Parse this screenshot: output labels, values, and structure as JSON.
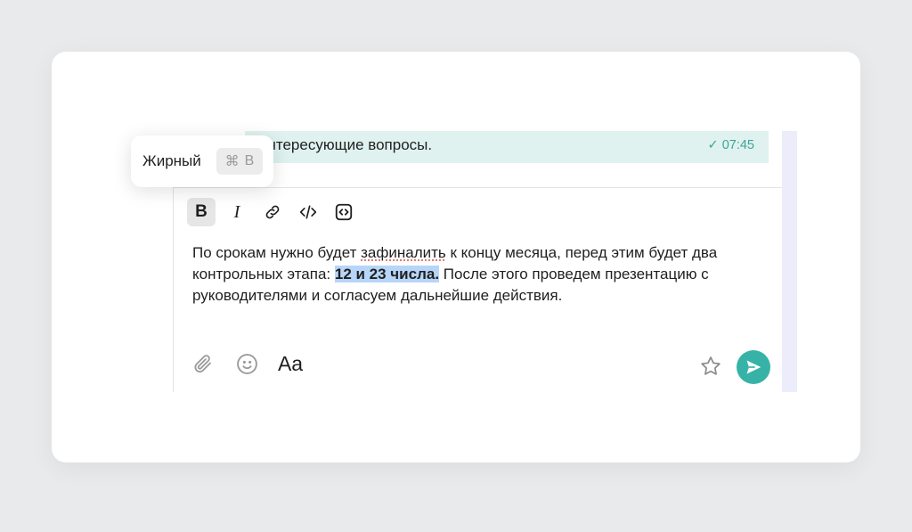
{
  "message": {
    "text": "интересующие вопросы.",
    "time": "07:45",
    "status_icon": "check-icon"
  },
  "toolbar": {
    "items": [
      {
        "name": "bold-button",
        "label": "B",
        "active": true
      },
      {
        "name": "italic-button",
        "label": "I"
      },
      {
        "name": "link-button",
        "icon": "link-icon"
      },
      {
        "name": "inline-code-button",
        "icon": "code-icon"
      },
      {
        "name": "code-block-button",
        "icon": "code-block-icon"
      }
    ]
  },
  "tooltip": {
    "label": "Жирный",
    "shortcut_symbol": "⌘",
    "shortcut_key": "B"
  },
  "editor": {
    "text_part1": "По срокам нужно будет ",
    "misspelled": "зафиналить",
    "text_part2": " к концу месяца, перед этим будет два контрольных этапа: ",
    "selected_bold": "12 и 23 числа.",
    "text_part3": " После этого проведем презентацию с руководителями и согласуем дальнейшие действия."
  },
  "bottom_bar": {
    "attach_icon": "paperclip-icon",
    "emoji_icon": "smile-icon",
    "format_label": "Aa",
    "favorite_icon": "star-icon",
    "send_icon": "send-icon"
  },
  "colors": {
    "accent": "#36b3a6",
    "message_bg": "#dff2ef",
    "selection": "#b7d5f8",
    "time_text": "#3ea39a"
  }
}
